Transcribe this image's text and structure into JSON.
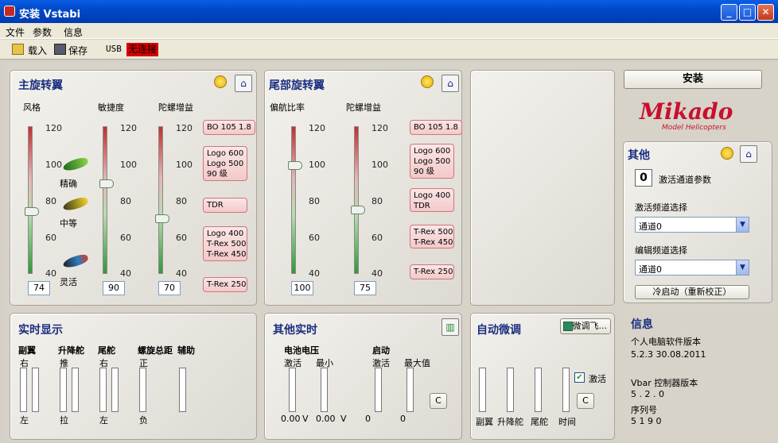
{
  "window": {
    "title": "安装 Vstabi"
  },
  "menu": [
    "文件",
    "参数",
    "信息"
  ],
  "toolbar": {
    "load": "载入",
    "save": "保存",
    "usb": "USB",
    "status": "无连接"
  },
  "colors": {
    "accent": "#1a2e80",
    "title_bar": "#0049c9",
    "status_bg": "#d50000"
  },
  "main_rotor": {
    "title": "主旋转翼",
    "labels": {
      "style": "风格",
      "sensitivity": "敏捷度",
      "gyro": "陀螺增益"
    },
    "ticks": [
      "120",
      "100",
      "80",
      "60",
      "40"
    ],
    "style_modes": [
      "精确",
      "中等",
      "灵活"
    ],
    "values": {
      "style": "74",
      "sensitivity": "90",
      "gyro": "70"
    },
    "gyro_presets": [
      "BO 105 1.8",
      "Logo 600\nLogo 500\n90 级",
      "TDR",
      "Logo 400\nT-Rex 500\nT-Rex 450",
      "T-Rex 250"
    ]
  },
  "tail_rotor": {
    "title": "尾部旋转翼",
    "labels": {
      "yaw_ratio": "偏航比率",
      "gyro": "陀螺增益"
    },
    "ticks": [
      "120",
      "100",
      "80",
      "60",
      "40"
    ],
    "values": {
      "yaw_ratio": "100",
      "gyro": "75"
    },
    "gyro_presets": [
      "BO 105 1.8",
      "Logo 600\nLogo 500\n90 级",
      "Logo 400\nTDR",
      "T-Rex 500\nT-Rex 450",
      "T-Rex 250"
    ]
  },
  "realtime": {
    "title": "实时显示",
    "cols": [
      {
        "name": "副翼",
        "top": "右",
        "bottom": "左"
      },
      {
        "name": "升降舵",
        "top": "推",
        "bottom": "拉"
      },
      {
        "name": "尾舵",
        "top": "右",
        "bottom": "左"
      },
      {
        "name": "螺旋总距",
        "top": "正",
        "bottom": "负"
      },
      {
        "name": "辅助",
        "top": "",
        "bottom": ""
      }
    ]
  },
  "other_realtime": {
    "title": "其他实时",
    "battery": "电池电压",
    "startup": "启动",
    "sub": {
      "active": "激活",
      "min": "最小",
      "active2": "激活",
      "max": "最大值"
    },
    "readings": [
      "0.00",
      "V",
      "0.00",
      "V",
      "0",
      "0"
    ],
    "clear": "C"
  },
  "auto_trim": {
    "title": "自动微调",
    "button": "微调飞...",
    "check_label": "激活",
    "bars": [
      "副翼",
      "升降舵",
      "尾舵",
      "时间"
    ],
    "clear": "C"
  },
  "right": {
    "install": "安装",
    "logo": "Mikado",
    "logo_sub": "Model Helicopters",
    "other_title": "其他",
    "count": "0",
    "count_label": "激活通道参数",
    "active_channel_label": "激活频道选择",
    "active_channel": "通道0",
    "edit_channel_label": "编辑频道选择",
    "edit_channel": "通道0",
    "cold_start": "冷启动（重新校正）",
    "info_title": "信息",
    "pc_version_label": "个人电脑软件版本",
    "pc_version": "5.2.3  30.08.2011",
    "vbar_version_label": "Vbar 控制器版本",
    "vbar_version": "5 . 2 . 0",
    "serial_label": "序列号",
    "serial": "5 1 9 0"
  }
}
